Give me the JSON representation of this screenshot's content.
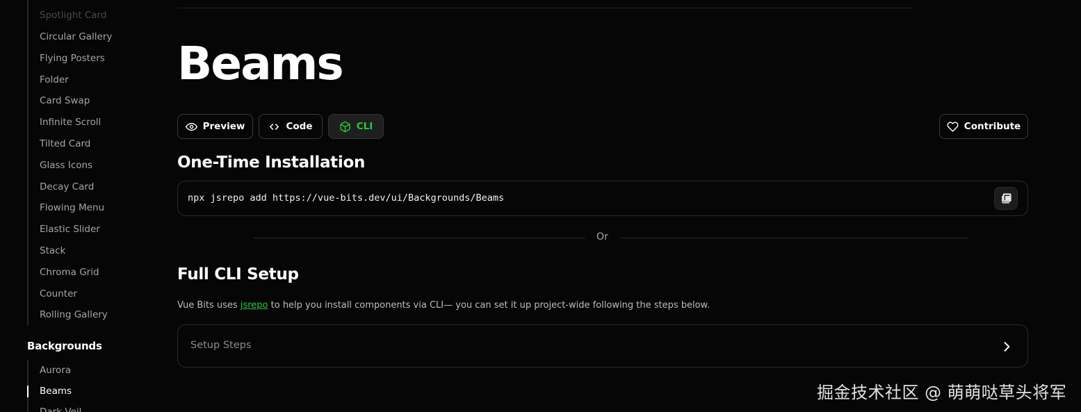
{
  "sidebar": {
    "items_top": [
      "Spotlight Card",
      "Circular Gallery",
      "Flying Posters",
      "Folder",
      "Card Swap",
      "Infinite Scroll",
      "Tilted Card",
      "Glass Icons",
      "Decay Card",
      "Flowing Menu",
      "Elastic Slider",
      "Stack",
      "Chroma Grid",
      "Counter",
      "Rolling Gallery"
    ],
    "section_title": "Backgrounds",
    "items_bottom": [
      "Aurora",
      "Beams",
      "Dark Veil"
    ],
    "active_item": "Beams"
  },
  "main": {
    "title": "Beams",
    "tabs": {
      "preview": "Preview",
      "code": "Code",
      "cli": "CLI",
      "contribute": "Contribute"
    },
    "installation": {
      "heading": "One-Time Installation",
      "command": "npx jsrepo add https://vue-bits.dev/ui/Backgrounds/Beams"
    },
    "or_text": "Or",
    "full_setup": {
      "heading": "Full CLI Setup",
      "desc_before": "Vue Bits uses ",
      "desc_link": "jsrepo",
      "desc_after": " to help you install components via CLI— you can set it up project-wide following the steps below.",
      "accordion_label": "Setup Steps"
    }
  },
  "watermark": "掘金技术社区 @ 萌萌哒草头将军",
  "colors": {
    "background": "#060606",
    "accent": "#27c93f",
    "border": "#2a2a2a"
  },
  "icons": {
    "preview": "eye-icon",
    "code": "code-brackets-icon",
    "cli": "cube-icon",
    "contribute": "heart-icon",
    "copy": "copy-icon",
    "accordion": "chevron-right-icon"
  }
}
